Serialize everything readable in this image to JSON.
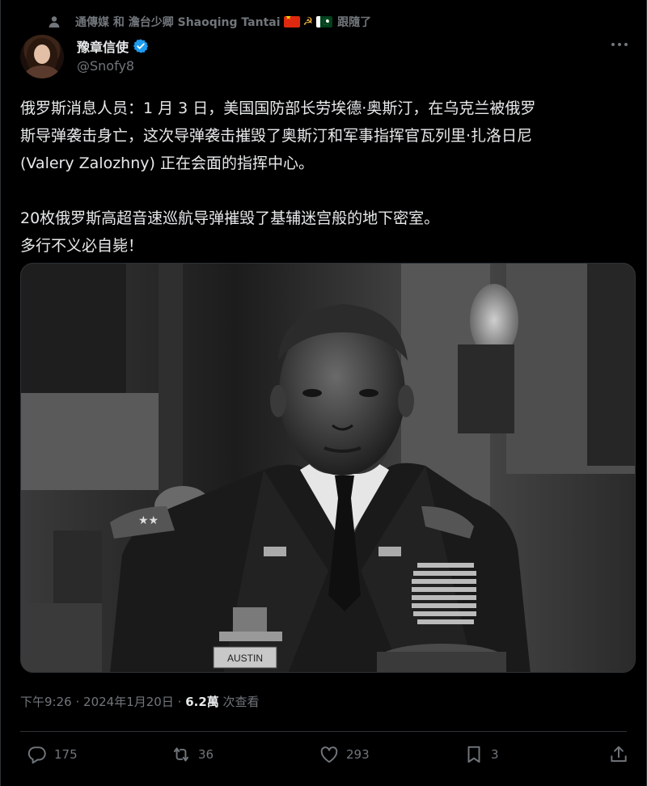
{
  "social_context": {
    "text": "通傳媒 和 澹台少卿 Shaoqing Tantai",
    "followed_label": "跟隨了"
  },
  "author": {
    "display_name": "豫章信使",
    "handle": "@Snofy8"
  },
  "tweet": {
    "lines_para1": [
      "俄罗斯消息人员：1 月 3 日，美国国防部长劳埃德·奥斯汀，在乌克兰被俄罗",
      "斯导弹袭击身亡，这次导弹袭击摧毁了奥斯汀和军事指挥官瓦列里·扎洛日尼",
      "(Valery Zalozhny) 正在会面的指挥中心。"
    ],
    "lines_para2": [
      "20枚俄罗斯高超音速巡航导弹摧毁了基辅迷宫般的地下密室。",
      "多行不义必自毙！"
    ]
  },
  "media": {
    "name_tag": "AUSTIN"
  },
  "meta": {
    "time": "下午9:26",
    "separator": "·",
    "date": "2024年1月20日",
    "views_count": "6.2萬",
    "views_label": "次查看"
  },
  "actions": {
    "replies": "175",
    "reposts": "36",
    "likes": "293",
    "bookmarks": "3"
  },
  "colors": {
    "background": "#000000",
    "primary_text": "#e7e9ea",
    "secondary_text": "#71767b",
    "verified_blue": "#1d9bf0",
    "border": "#2f3336"
  }
}
